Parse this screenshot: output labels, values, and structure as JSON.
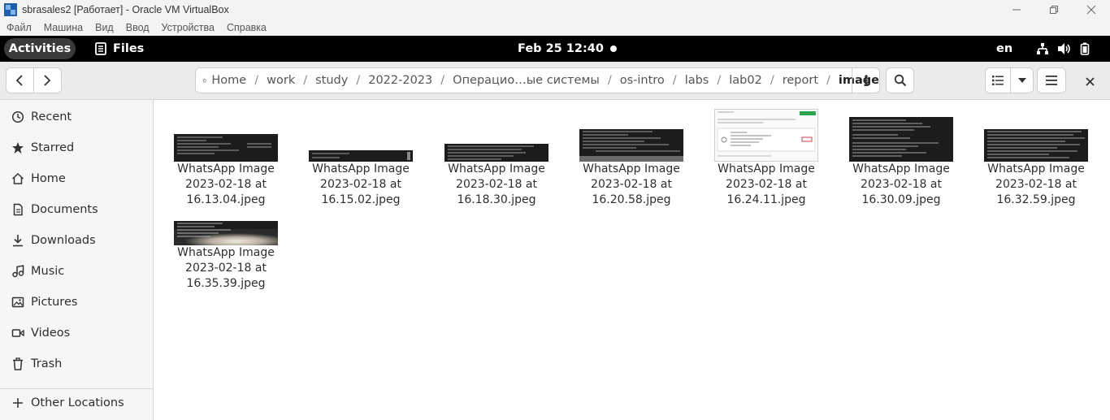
{
  "host_window": {
    "title": "sbrasales2 [Работает] - Oracle VM VirtualBox",
    "menu": [
      "Файл",
      "Машина",
      "Вид",
      "Ввод",
      "Устройства",
      "Справка"
    ]
  },
  "topbar": {
    "activities": "Activities",
    "app_name": "Files",
    "clock": "Feb 25  12:40",
    "language": "en"
  },
  "pathbar": {
    "crumbs": [
      "Home",
      "work",
      "study",
      "2022-2023",
      "Операцио…ые системы",
      "os-intro",
      "labs",
      "lab02",
      "report",
      "image"
    ]
  },
  "sidebar": {
    "items": [
      {
        "label": "Recent",
        "icon": "clock-icon"
      },
      {
        "label": "Starred",
        "icon": "star-icon"
      },
      {
        "label": "Home",
        "icon": "home-icon"
      },
      {
        "label": "Documents",
        "icon": "document-icon"
      },
      {
        "label": "Downloads",
        "icon": "download-icon"
      },
      {
        "label": "Music",
        "icon": "music-icon"
      },
      {
        "label": "Pictures",
        "icon": "picture-icon"
      },
      {
        "label": "Videos",
        "icon": "video-icon"
      },
      {
        "label": "Trash",
        "icon": "trash-icon"
      }
    ],
    "other_locations": "Other Locations"
  },
  "files": [
    {
      "line1": "WhatsApp Image",
      "line2": "2023-02-18 at",
      "line3": "16.13.04.jpeg",
      "thumb": "terminal"
    },
    {
      "line1": "WhatsApp Image",
      "line2": "2023-02-18 at",
      "line3": "16.15.02.jpeg",
      "thumb": "terminal-thin"
    },
    {
      "line1": "WhatsApp Image",
      "line2": "2023-02-18 at",
      "line3": "16.18.30.jpeg",
      "thumb": "terminal-wide"
    },
    {
      "line1": "WhatsApp Image",
      "line2": "2023-02-18 at",
      "line3": "16.20.58.jpeg",
      "thumb": "terminal"
    },
    {
      "line1": "WhatsApp Image",
      "line2": "2023-02-18 at",
      "line3": "16.24.11.jpeg",
      "thumb": "webpage"
    },
    {
      "line1": "WhatsApp Image",
      "line2": "2023-02-18 at",
      "line3": "16.30.09.jpeg",
      "thumb": "terminal-tall"
    },
    {
      "line1": "WhatsApp Image",
      "line2": "2023-02-18 at",
      "line3": "16.32.59.jpeg",
      "thumb": "terminal-tall"
    },
    {
      "line1": "WhatsApp Image",
      "line2": "2023-02-18 at",
      "line3": "16.35.39.jpeg",
      "thumb": "photo"
    }
  ]
}
